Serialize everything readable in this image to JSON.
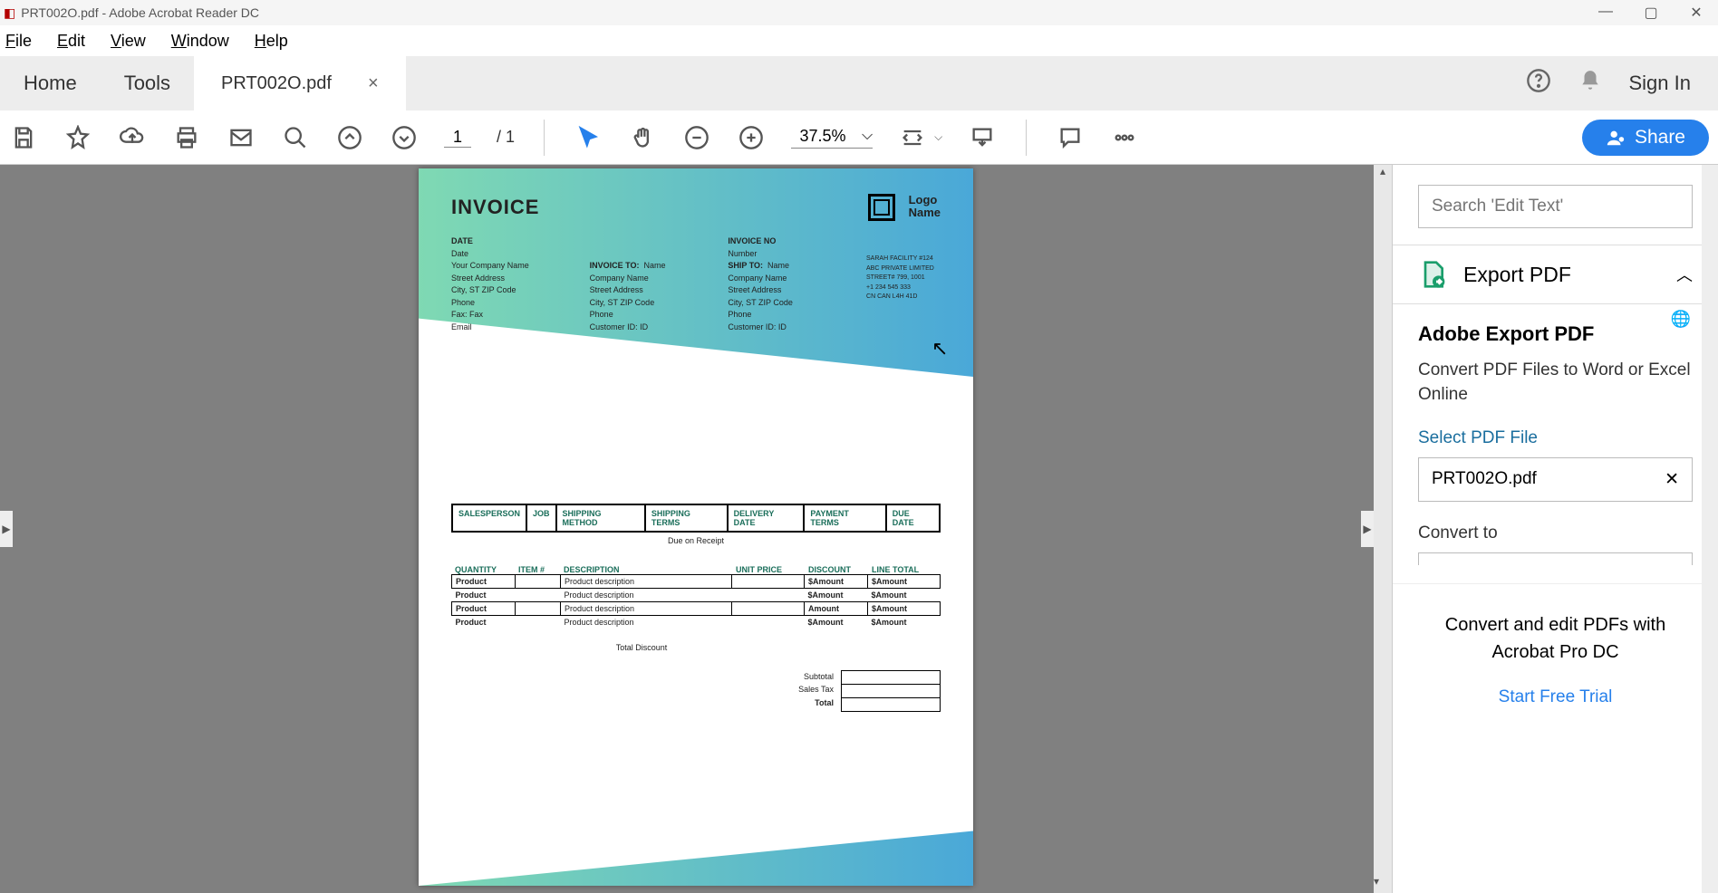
{
  "window": {
    "title": "PRT002O.pdf - Adobe Acrobat Reader DC"
  },
  "menu": {
    "file": "File",
    "edit": "Edit",
    "view": "View",
    "window": "Window",
    "help": "Help"
  },
  "tabs": {
    "home": "Home",
    "tools": "Tools",
    "file": "PRT002O.pdf",
    "signin": "Sign In"
  },
  "toolbar": {
    "page_current": "1",
    "page_total": "1",
    "zoom": "37.5%",
    "share": "Share"
  },
  "rpane": {
    "search_placeholder": "Search 'Edit Text'",
    "export_title": "Export PDF",
    "section_title": "Adobe Export PDF",
    "section_desc": "Convert PDF Files to Word or Excel Online",
    "select_label": "Select PDF File",
    "selected_file": "PRT002O.pdf",
    "convert_label": "Convert to",
    "promo_title": "Convert and edit PDFs with Acrobat Pro DC",
    "promo_link": "Start Free Trial"
  },
  "doc": {
    "invoice": "INVOICE",
    "logo_line1": "Logo",
    "logo_line2": "Name",
    "date_label": "DATE",
    "date_val": "Date",
    "invno_label": "INVOICE NO",
    "invno_val": "Number",
    "invoice_to": "INVOICE TO:",
    "ship_to": "SHIP TO:",
    "company": [
      "Your Company Name",
      "Street Address",
      "City, ST ZIP Code",
      "Phone",
      "Fax: Fax",
      "Email"
    ],
    "billto": [
      "Name",
      "Company Name",
      "Street Address",
      "City, ST ZIP Code",
      "Phone",
      "Customer ID: ID"
    ],
    "shipto": [
      "Name",
      "Company Name",
      "Street Address",
      "City, ST ZIP Code",
      "Phone",
      "Customer ID: ID"
    ],
    "tiny": [
      "SARAH FACILITY #124",
      "ABC PRIVATE LIMITED",
      "STREET# 799, 1001",
      "+1 234 545 333",
      "CN  CAN  L4H 41D"
    ],
    "order_headers": [
      "SALESPERSON",
      "JOB",
      "SHIPPING METHOD",
      "SHIPPING TERMS",
      "DELIVERY DATE",
      "PAYMENT TERMS",
      "DUE DATE"
    ],
    "due_on": "Due on Receipt",
    "item_headers": [
      "QUANTITY",
      "ITEM #",
      "DESCRIPTION",
      "UNIT PRICE",
      "DISCOUNT",
      "LINE TOTAL"
    ],
    "items": [
      {
        "q": "Product",
        "d": "Product description",
        "disc": "$Amount",
        "lt": "$Amount"
      },
      {
        "q": "Product",
        "d": "Product description",
        "disc": "$Amount",
        "lt": "$Amount"
      },
      {
        "q": "Product",
        "d": "Product description",
        "disc": "Amount",
        "lt": "$Amount"
      },
      {
        "q": "Product",
        "d": "Product description",
        "disc": "$Amount",
        "lt": "$Amount"
      }
    ],
    "total_discount": "Total Discount",
    "totals": [
      "Subtotal",
      "Sales Tax",
      "Total"
    ]
  }
}
